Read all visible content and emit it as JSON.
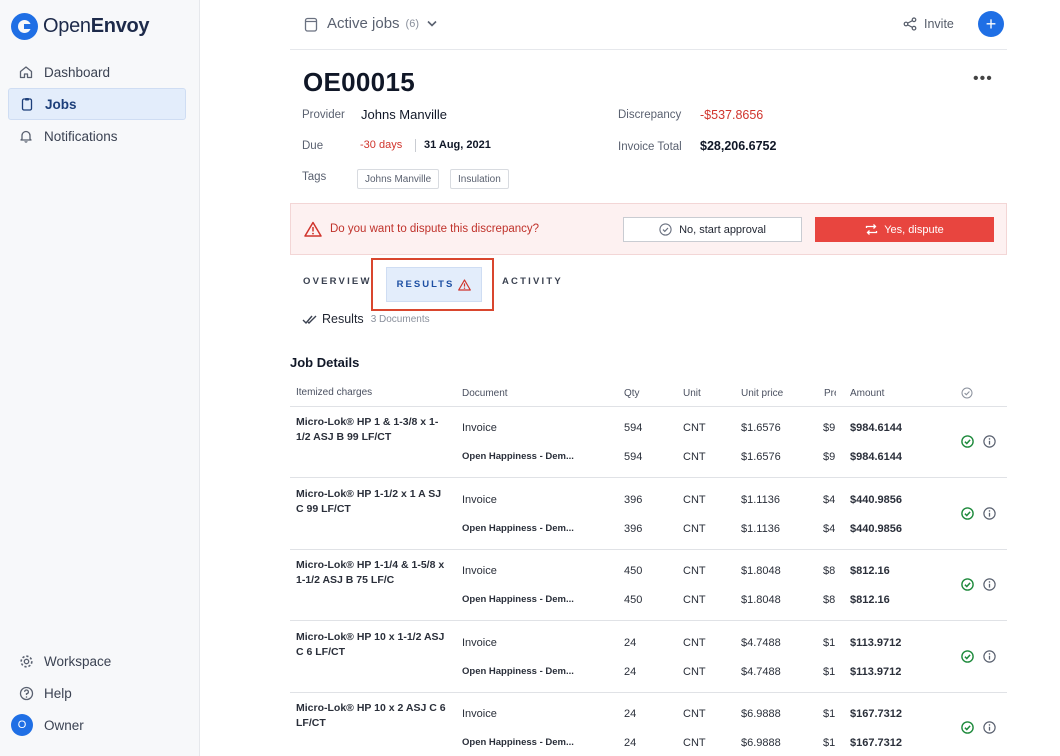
{
  "app": {
    "brand_light": "Open",
    "brand_bold": "Envoy"
  },
  "sidebar": {
    "items": [
      {
        "label": "Dashboard",
        "icon": "home-icon",
        "active": false
      },
      {
        "label": "Jobs",
        "icon": "clipboard-icon",
        "active": true
      },
      {
        "label": "Notifications",
        "icon": "bell-icon",
        "active": false
      }
    ],
    "footer": [
      {
        "label": "Workspace",
        "icon": "gear-icon"
      },
      {
        "label": "Help",
        "icon": "help-icon"
      }
    ],
    "user": {
      "initial": "O",
      "label": "Owner"
    }
  },
  "header": {
    "title": "Active jobs",
    "count": "(6)",
    "invite_label": "Invite",
    "plus_label": "+"
  },
  "job": {
    "id": "OE00015",
    "more_label": "•••",
    "provider_label": "Provider",
    "provider": "Johns Manville",
    "due_label": "Due",
    "due_relative": "-30 days",
    "due_date": "31 Aug, 2021",
    "tags_label": "Tags",
    "tags": [
      "Johns Manville",
      "Insulation"
    ],
    "discrepancy_label": "Discrepancy",
    "discrepancy": "-$537.8656",
    "invoice_total_label": "Invoice Total",
    "invoice_total": "$28,206.6752"
  },
  "dispute": {
    "question": "Do you want to dispute this discrepancy?",
    "approve_label": "No, start approval",
    "dispute_label": "Yes, dispute"
  },
  "tabs": {
    "overview": "OVERVIEW",
    "results": "RESULTS",
    "activity": "ACTIVITY"
  },
  "results": {
    "title": "Results",
    "docs": "3 Documents"
  },
  "job_details": {
    "title": "Job Details",
    "columns": [
      "Itemized charges",
      "Document",
      "Qty",
      "Unit",
      "Unit price",
      "Pre",
      "Amount"
    ],
    "rows": [
      {
        "charge": "Micro-Lok® HP 1 & 1-3/8 x 1-1/2 ASJ B 99 LF/CT",
        "lines": [
          {
            "doc": "Invoice",
            "qty": "594",
            "unit": "CNT",
            "price": "$1.6576",
            "pre": "$9",
            "amount": "$984.6144"
          },
          {
            "doc": "Open Happiness - Dem...",
            "qty": "594",
            "unit": "CNT",
            "price": "$1.6576",
            "pre": "$9",
            "amount": "$984.6144"
          }
        ]
      },
      {
        "charge": "Micro-Lok® HP 1-1/2 x 1 A SJ C 99 LF/CT",
        "lines": [
          {
            "doc": "Invoice",
            "qty": "396",
            "unit": "CNT",
            "price": "$1.1136",
            "pre": "$4",
            "amount": "$440.9856"
          },
          {
            "doc": "Open Happiness - Dem...",
            "qty": "396",
            "unit": "CNT",
            "price": "$1.1136",
            "pre": "$4",
            "amount": "$440.9856"
          }
        ]
      },
      {
        "charge": "Micro-Lok® HP 1-1/4 & 1-5/8 x 1-1/2 ASJ B 75 LF/C",
        "lines": [
          {
            "doc": "Invoice",
            "qty": "450",
            "unit": "CNT",
            "price": "$1.8048",
            "pre": "$8",
            "amount": "$812.16"
          },
          {
            "doc": "Open Happiness - Dem...",
            "qty": "450",
            "unit": "CNT",
            "price": "$1.8048",
            "pre": "$8",
            "amount": "$812.16"
          }
        ]
      },
      {
        "charge": "Micro-Lok® HP 10 x 1-1/2 ASJ C 6 LF/CT",
        "lines": [
          {
            "doc": "Invoice",
            "qty": "24",
            "unit": "CNT",
            "price": "$4.7488",
            "pre": "$1",
            "amount": "$113.9712"
          },
          {
            "doc": "Open Happiness - Dem...",
            "qty": "24",
            "unit": "CNT",
            "price": "$4.7488",
            "pre": "$1",
            "amount": "$113.9712"
          }
        ]
      },
      {
        "charge": "Micro-Lok® HP 10 x 2 ASJ C 6 LF/CT",
        "lines": [
          {
            "doc": "Invoice",
            "qty": "24",
            "unit": "CNT",
            "price": "$6.9888",
            "pre": "$1",
            "amount": "$167.7312"
          },
          {
            "doc": "Open Happiness - Dem...",
            "qty": "24",
            "unit": "CNT",
            "price": "$6.9888",
            "pre": "$1",
            "amount": "$167.7312"
          }
        ]
      }
    ]
  },
  "colors": {
    "accent": "#1f6fe5",
    "danger": "#e8453f",
    "success": "#1e8a3c"
  }
}
